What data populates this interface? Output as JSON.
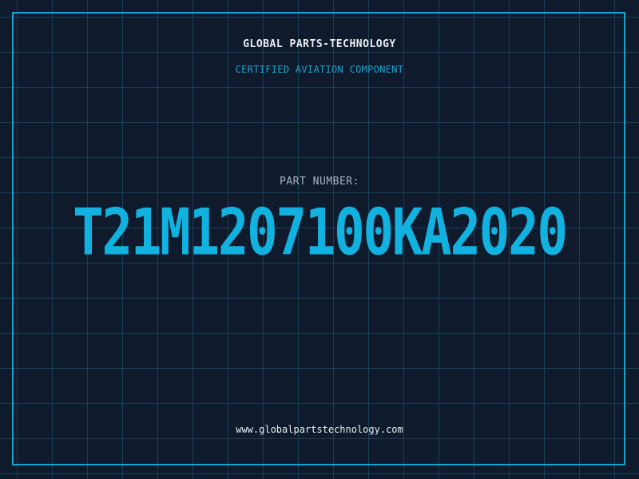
{
  "header": {
    "company_name": "GLOBAL PARTS-TECHNOLOGY",
    "subtitle": "CERTIFIED AVIATION COMPONENT"
  },
  "part": {
    "label": "PART NUMBER:",
    "number": "T21M1207100KA2020"
  },
  "footer": {
    "website": "www.globalpartstechnology.com"
  },
  "colors": {
    "background": "#101a2d",
    "grid": "#1e5f78",
    "accent": "#12b2e0",
    "text": "#e8eef5",
    "muted_text": "#a8b4c4"
  }
}
